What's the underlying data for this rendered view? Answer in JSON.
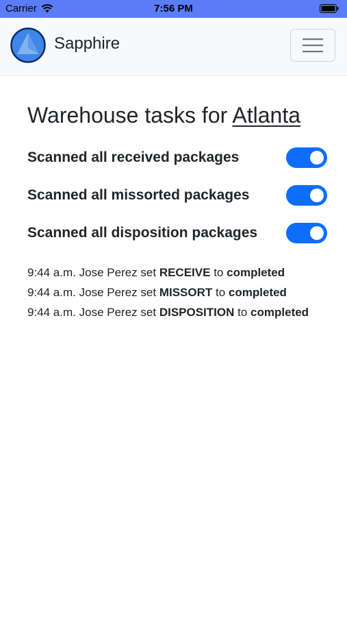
{
  "status_bar": {
    "carrier": "Carrier",
    "time": "7:56 PM",
    "background": "#5b7cf7"
  },
  "navbar": {
    "brand_name": "Sapphire",
    "logo_icon": "sapphire-logo-icon",
    "menu_icon": "hamburger-menu-icon"
  },
  "page": {
    "title_prefix": "Warehouse tasks for",
    "city": "Atlanta"
  },
  "tasks": [
    {
      "label": "Scanned all received packages",
      "checked": true
    },
    {
      "label": "Scanned all missorted packages",
      "checked": true
    },
    {
      "label": "Scanned all disposition packages",
      "checked": true
    }
  ],
  "log": [
    {
      "time": "9:44 a.m.",
      "user": "Jose Perez",
      "verb": "set",
      "task": "RECEIVE",
      "to": "to",
      "status": "completed"
    },
    {
      "time": "9:44 a.m.",
      "user": "Jose Perez",
      "verb": "set",
      "task": "MISSORT",
      "to": "to",
      "status": "completed"
    },
    {
      "time": "9:44 a.m.",
      "user": "Jose Perez",
      "verb": "set",
      "task": "DISPOSITION",
      "to": "to",
      "status": "completed"
    }
  ],
  "colors": {
    "accent": "#0d6efd",
    "navbar_bg": "#f8f9fa",
    "text": "#212529"
  }
}
